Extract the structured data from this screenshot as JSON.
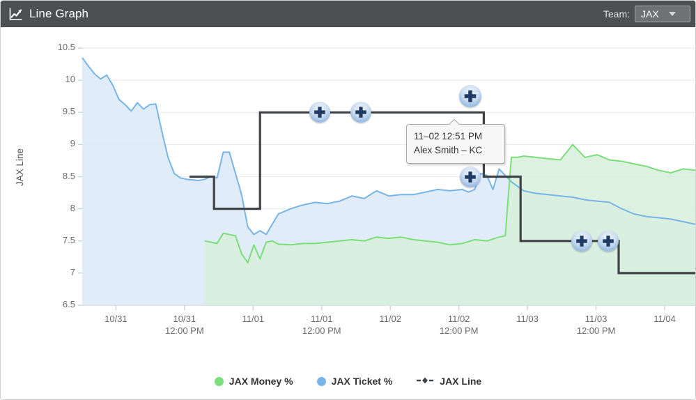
{
  "header": {
    "title": "Line Graph",
    "icon": "line-chart-icon",
    "team_label": "Team:",
    "team_selected": "JAX",
    "team_options": [
      "JAX"
    ],
    "bg_color": "#4d4f53"
  },
  "tooltip": {
    "line1": "11–02 12:51 PM",
    "line2": "Alex Smith – KC"
  },
  "legend": [
    {
      "label": "JAX Money %",
      "color": "#7ade79",
      "marker": "dot"
    },
    {
      "label": "JAX Ticket %",
      "color": "#77b4e8",
      "marker": "dot"
    },
    {
      "label": "JAX Line",
      "color": "#3f4247",
      "marker": "dashed-diamond"
    }
  ],
  "chart_data": {
    "type": "line",
    "title": "Line Graph",
    "xlabel": "",
    "ylabel": "JAX Line",
    "grid": true,
    "legend_position": "bottom",
    "ylim": [
      6.5,
      10.5
    ],
    "yticks": [
      "6.5",
      "7",
      "7.5",
      "8",
      "8.5",
      "9",
      "9.5",
      "10",
      "10.5"
    ],
    "xticks": [
      {
        "date": "10/31",
        "time": ""
      },
      {
        "date": "10/31",
        "time": "12:00 PM"
      },
      {
        "date": "11/01",
        "time": ""
      },
      {
        "date": "11/01",
        "time": "12:00 PM"
      },
      {
        "date": "11/02",
        "time": ""
      },
      {
        "date": "11/02",
        "time": "12:00 PM"
      },
      {
        "date": "11/03",
        "time": ""
      },
      {
        "date": "11/03",
        "time": "12:00 PM"
      },
      {
        "date": "11/04",
        "time": ""
      }
    ],
    "xlim_labels": [
      "10/31",
      "11/04"
    ],
    "series": [
      {
        "name": "JAX Ticket %",
        "color": "#77b4e8",
        "fill": "#dbeaf8",
        "type": "area",
        "x": [
          0.0,
          0.01,
          0.02,
          0.03,
          0.04,
          0.05,
          0.06,
          0.07,
          0.08,
          0.09,
          0.1,
          0.11,
          0.12,
          0.13,
          0.14,
          0.15,
          0.16,
          0.17,
          0.18,
          0.19,
          0.2,
          0.21,
          0.22,
          0.23,
          0.24,
          0.25,
          0.26,
          0.27,
          0.28,
          0.29,
          0.3,
          0.32,
          0.34,
          0.36,
          0.38,
          0.4,
          0.42,
          0.44,
          0.46,
          0.48,
          0.5,
          0.52,
          0.54,
          0.56,
          0.58,
          0.6,
          0.62,
          0.63,
          0.64,
          0.65,
          0.66,
          0.67,
          0.68,
          0.7,
          0.72,
          0.74,
          0.76,
          0.78,
          0.8,
          0.82,
          0.84,
          0.86,
          0.88,
          0.9,
          0.92,
          0.94,
          0.96,
          0.98,
          1.0
        ],
        "values": [
          10.35,
          10.22,
          10.1,
          10.02,
          10.08,
          9.92,
          9.7,
          9.62,
          9.52,
          9.65,
          9.55,
          9.62,
          9.63,
          9.2,
          8.8,
          8.55,
          8.48,
          8.46,
          8.45,
          8.44,
          8.46,
          8.5,
          8.48,
          8.88,
          8.88,
          8.55,
          8.22,
          7.72,
          7.6,
          7.66,
          7.6,
          7.92,
          8.0,
          8.06,
          8.1,
          8.08,
          8.12,
          8.2,
          8.16,
          8.28,
          8.2,
          8.22,
          8.22,
          8.26,
          8.3,
          8.28,
          8.3,
          8.26,
          8.3,
          8.55,
          8.52,
          8.3,
          8.62,
          8.42,
          8.28,
          8.24,
          8.22,
          8.2,
          8.18,
          8.14,
          8.12,
          8.1,
          8.0,
          7.92,
          7.88,
          7.86,
          7.84,
          7.8,
          7.76
        ]
      },
      {
        "name": "JAX Money %",
        "color": "#7ade79",
        "fill": "#d7efda",
        "type": "area",
        "x": [
          0.2,
          0.21,
          0.22,
          0.23,
          0.24,
          0.25,
          0.26,
          0.27,
          0.28,
          0.29,
          0.3,
          0.31,
          0.32,
          0.34,
          0.36,
          0.38,
          0.4,
          0.42,
          0.44,
          0.46,
          0.48,
          0.5,
          0.52,
          0.54,
          0.56,
          0.58,
          0.6,
          0.62,
          0.64,
          0.66,
          0.68,
          0.69,
          0.7,
          0.71,
          0.72,
          0.74,
          0.76,
          0.78,
          0.8,
          0.82,
          0.84,
          0.86,
          0.88,
          0.9,
          0.92,
          0.94,
          0.96,
          0.98,
          1.0
        ],
        "values": [
          7.5,
          7.48,
          7.46,
          7.62,
          7.6,
          7.58,
          7.3,
          7.16,
          7.44,
          7.22,
          7.48,
          7.5,
          7.45,
          7.44,
          7.46,
          7.46,
          7.48,
          7.5,
          7.52,
          7.5,
          7.56,
          7.54,
          7.56,
          7.52,
          7.5,
          7.48,
          7.44,
          7.46,
          7.52,
          7.5,
          7.56,
          7.58,
          8.8,
          8.8,
          8.82,
          8.8,
          8.78,
          8.76,
          9.0,
          8.8,
          8.84,
          8.76,
          8.74,
          8.7,
          8.66,
          8.6,
          8.56,
          8.62,
          8.6
        ]
      },
      {
        "name": "JAX Line",
        "color": "#3f4247",
        "type": "step",
        "x": [
          0.175,
          0.215,
          0.215,
          0.29,
          0.29,
          0.655,
          0.655,
          0.715,
          0.715,
          0.875,
          0.875,
          1.0
        ],
        "values": [
          8.5,
          8.5,
          8.0,
          8.0,
          9.5,
          9.5,
          8.5,
          8.5,
          7.5,
          7.5,
          7.0,
          7.0
        ],
        "markers": [
          {
            "x": 0.388,
            "y": 9.5,
            "label": "marker"
          },
          {
            "x": 0.455,
            "y": 9.5,
            "label": "marker"
          },
          {
            "x": 0.633,
            "y": 9.75,
            "label": "marker-selected"
          },
          {
            "x": 0.633,
            "y": 9.0,
            "label": "marker"
          },
          {
            "x": 0.633,
            "y": 8.5,
            "label": "marker"
          },
          {
            "x": 0.815,
            "y": 7.5,
            "label": "marker"
          },
          {
            "x": 0.858,
            "y": 7.5,
            "label": "marker"
          }
        ]
      }
    ]
  }
}
